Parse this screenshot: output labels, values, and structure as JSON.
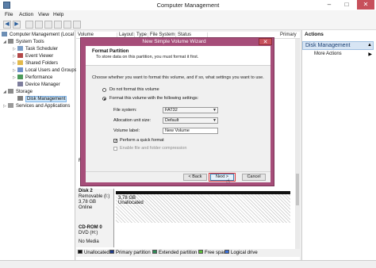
{
  "window": {
    "title": "Computer Management",
    "controls": {
      "minimize": "–",
      "maximize": "□",
      "close": "✕"
    }
  },
  "menu": [
    "File",
    "Action",
    "View",
    "Help"
  ],
  "toolbar": {
    "back": "◀",
    "forward": "▶"
  },
  "tree": {
    "root": "Computer Management (Local",
    "system_tools": "System Tools",
    "task_scheduler": "Task Scheduler",
    "event_viewer": "Event Viewer",
    "shared_folders": "Shared Folders",
    "local_users": "Local Users and Groups",
    "performance": "Performance",
    "device_manager": "Device Manager",
    "storage": "Storage",
    "disk_management": "Disk Management",
    "services": "Services and Applications"
  },
  "list_columns": [
    "Volume",
    "Layout",
    "Type",
    "File System",
    "Status"
  ],
  "list_extra": "Primary",
  "actions": {
    "title": "Actions",
    "section": "Disk Management",
    "more": "More Actions"
  },
  "disks": {
    "disk2": {
      "name": "Disk 2",
      "type": "Removable (I:)",
      "size": "3,78 GB",
      "state": "Online",
      "part_size": "3,78 GB",
      "part_status": "Unallocated"
    },
    "cdrom": {
      "name": "CD-ROM 0",
      "drive": "DVD (H:)",
      "media": "No Media"
    },
    "partial_letter": "R"
  },
  "legend": [
    {
      "label": "Unallocated",
      "color": "#111111"
    },
    {
      "label": "Primary partition",
      "color": "#1e3c8c"
    },
    {
      "label": "Extended partition",
      "color": "#2e8b57"
    },
    {
      "label": "Free space",
      "color": "#5bbf3a"
    },
    {
      "label": "Logical drive",
      "color": "#3a6fd8"
    }
  ],
  "dialog": {
    "title": "New Simple Volume Wizard",
    "close": "✕",
    "heading": "Format Partition",
    "subheading": "To store data on this partition, you must format it first.",
    "instruction": "Choose whether you want to format this volume, and if so, what settings you want to use.",
    "opt_no_format": "Do not format this volume",
    "opt_format": "Format this volume with the following settings:",
    "file_system_label": "File system:",
    "file_system_value": "FAT32",
    "alloc_label": "Allocation unit size:",
    "alloc_value": "Default",
    "volume_label_label": "Volume label:",
    "volume_label_value": "New Volume",
    "quick_format": "Perform a quick format",
    "compression": "Enable file and folder compression",
    "back": "< Back",
    "next": "Next >",
    "cancel": "Cancel"
  }
}
